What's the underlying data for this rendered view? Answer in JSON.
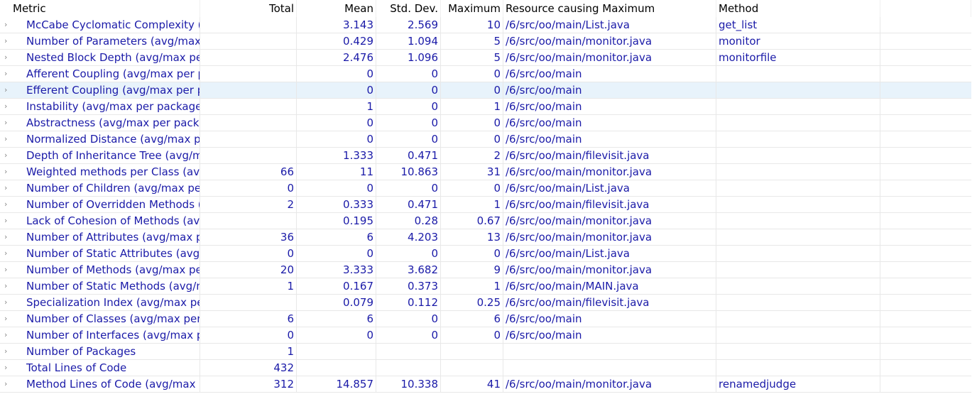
{
  "columns": [
    "Metric",
    "Total",
    "Mean",
    "Std. Dev.",
    "Maximum",
    "Resource causing Maximum",
    "Method"
  ],
  "rows": [
    {
      "metric": "McCabe Cyclomatic Complexity (a",
      "total": "",
      "mean": "3.143",
      "std": "2.569",
      "max": "10",
      "resource": "/6/src/oo/main/List.java",
      "method": "get_list"
    },
    {
      "metric": "Number of Parameters (avg/max p",
      "total": "",
      "mean": "0.429",
      "std": "1.094",
      "max": "5",
      "resource": "/6/src/oo/main/monitor.java",
      "method": "monitor"
    },
    {
      "metric": "Nested Block Depth (avg/max per",
      "total": "",
      "mean": "2.476",
      "std": "1.096",
      "max": "5",
      "resource": "/6/src/oo/main/monitor.java",
      "method": "monitorfile"
    },
    {
      "metric": "Afferent Coupling (avg/max per p",
      "total": "",
      "mean": "0",
      "std": "0",
      "max": "0",
      "resource": "/6/src/oo/main",
      "method": ""
    },
    {
      "metric": "Efferent Coupling (avg/max per pa",
      "total": "",
      "mean": "0",
      "std": "0",
      "max": "0",
      "resource": "/6/src/oo/main",
      "method": ""
    },
    {
      "metric": "Instability (avg/max per packageFr",
      "total": "",
      "mean": "1",
      "std": "0",
      "max": "1",
      "resource": "/6/src/oo/main",
      "method": ""
    },
    {
      "metric": "Abstractness (avg/max per packag",
      "total": "",
      "mean": "0",
      "std": "0",
      "max": "0",
      "resource": "/6/src/oo/main",
      "method": ""
    },
    {
      "metric": "Normalized Distance (avg/max pe",
      "total": "",
      "mean": "0",
      "std": "0",
      "max": "0",
      "resource": "/6/src/oo/main",
      "method": ""
    },
    {
      "metric": "Depth of Inheritance Tree (avg/ma",
      "total": "",
      "mean": "1.333",
      "std": "0.471",
      "max": "2",
      "resource": "/6/src/oo/main/filevisit.java",
      "method": ""
    },
    {
      "metric": "Weighted methods per Class (avg",
      "total": "66",
      "mean": "11",
      "std": "10.863",
      "max": "31",
      "resource": "/6/src/oo/main/monitor.java",
      "method": ""
    },
    {
      "metric": "Number of Children (avg/max per",
      "total": "0",
      "mean": "0",
      "std": "0",
      "max": "0",
      "resource": "/6/src/oo/main/List.java",
      "method": ""
    },
    {
      "metric": "Number of Overridden Methods (",
      "total": "2",
      "mean": "0.333",
      "std": "0.471",
      "max": "1",
      "resource": "/6/src/oo/main/filevisit.java",
      "method": ""
    },
    {
      "metric": "Lack of Cohesion of Methods (avg",
      "total": "",
      "mean": "0.195",
      "std": "0.28",
      "max": "0.67",
      "resource": "/6/src/oo/main/monitor.java",
      "method": ""
    },
    {
      "metric": "Number of Attributes (avg/max pe",
      "total": "36",
      "mean": "6",
      "std": "4.203",
      "max": "13",
      "resource": "/6/src/oo/main/monitor.java",
      "method": ""
    },
    {
      "metric": "Number of Static Attributes (avg/r",
      "total": "0",
      "mean": "0",
      "std": "0",
      "max": "0",
      "resource": "/6/src/oo/main/List.java",
      "method": ""
    },
    {
      "metric": "Number of Methods (avg/max per",
      "total": "20",
      "mean": "3.333",
      "std": "3.682",
      "max": "9",
      "resource": "/6/src/oo/main/monitor.java",
      "method": ""
    },
    {
      "metric": "Number of Static Methods (avg/m",
      "total": "1",
      "mean": "0.167",
      "std": "0.373",
      "max": "1",
      "resource": "/6/src/oo/main/MAIN.java",
      "method": ""
    },
    {
      "metric": "Specialization Index (avg/max per",
      "total": "",
      "mean": "0.079",
      "std": "0.112",
      "max": "0.25",
      "resource": "/6/src/oo/main/filevisit.java",
      "method": ""
    },
    {
      "metric": "Number of Classes (avg/max per p",
      "total": "6",
      "mean": "6",
      "std": "0",
      "max": "6",
      "resource": "/6/src/oo/main",
      "method": ""
    },
    {
      "metric": "Number of Interfaces (avg/max pe",
      "total": "0",
      "mean": "0",
      "std": "0",
      "max": "0",
      "resource": "/6/src/oo/main",
      "method": ""
    },
    {
      "metric": "Number of Packages",
      "total": "1",
      "mean": "",
      "std": "",
      "max": "",
      "resource": "",
      "method": ""
    },
    {
      "metric": "Total Lines of Code",
      "total": "432",
      "mean": "",
      "std": "",
      "max": "",
      "resource": "",
      "method": ""
    },
    {
      "metric": "Method Lines of Code (avg/max p",
      "total": "312",
      "mean": "14.857",
      "std": "10.338",
      "max": "41",
      "resource": "/6/src/oo/main/monitor.java",
      "method": "renamedjudge"
    }
  ],
  "selected_row": 4,
  "icons": {
    "expand": "chevron-right-icon"
  },
  "colors": {
    "link_text": "#1a1aa8",
    "selection": "#e8f3fb",
    "grid": "#e8e8e8"
  }
}
